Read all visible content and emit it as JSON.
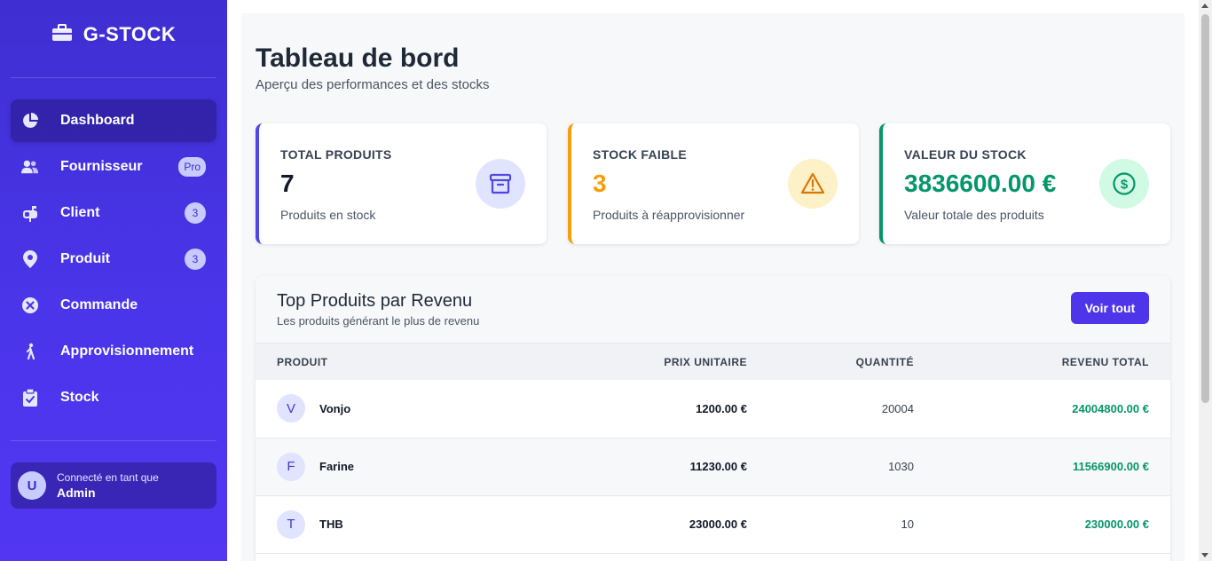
{
  "sidebar": {
    "brand": "G-STOCK",
    "items": [
      {
        "label": "Dashboard",
        "icon": "pie-chart-icon",
        "active": true,
        "badge": ""
      },
      {
        "label": "Fournisseur",
        "icon": "users-icon",
        "active": false,
        "badge": "Pro"
      },
      {
        "label": "Client",
        "icon": "mailbox-icon",
        "active": false,
        "badge": "3"
      },
      {
        "label": "Produit",
        "icon": "location-pin-icon",
        "active": false,
        "badge": "3"
      },
      {
        "label": "Commande",
        "icon": "x-circle-icon",
        "active": false,
        "badge": ""
      },
      {
        "label": "Approvisionnement",
        "icon": "person-walking-icon",
        "active": false,
        "badge": ""
      },
      {
        "label": "Stock",
        "icon": "clipboard-check-icon",
        "active": false,
        "badge": ""
      }
    ],
    "user": {
      "avatar_letter": "U",
      "caption": "Connecté en tant que",
      "name": "Admin"
    }
  },
  "header": {
    "title": "Tableau de bord",
    "subtitle": "Aperçu des performances et des stocks"
  },
  "stats": [
    {
      "label": "TOTAL PRODUITS",
      "value": "7",
      "description": "Produits en stock",
      "color": "#4f46e5",
      "icon": "archive-box-icon"
    },
    {
      "label": "STOCK FAIBLE",
      "value": "3",
      "description": "Produits à réapprovisionner",
      "color": "#f59e0b",
      "icon": "warning-triangle-icon"
    },
    {
      "label": "VALEUR DU STOCK",
      "value": "3836600.00 €",
      "description": "Valeur totale des produits",
      "color": "#059669",
      "icon": "dollar-circle-icon"
    }
  ],
  "top_products": {
    "title": "Top Produits par Revenu",
    "subtitle": "Les produits générant le plus de revenu",
    "button_label": "Voir tout",
    "columns": [
      "PRODUIT",
      "PRIX UNITAIRE",
      "QUANTITÉ",
      "REVENU TOTAL"
    ],
    "rows": [
      {
        "letter": "V",
        "name": "Vonjo",
        "price": "1200.00 €",
        "quantity": "20004",
        "revenue": "24004800.00 €"
      },
      {
        "letter": "F",
        "name": "Farine",
        "price": "11230.00 €",
        "quantity": "1030",
        "revenue": "11566900.00 €"
      },
      {
        "letter": "T",
        "name": "THB",
        "price": "23000.00 €",
        "quantity": "10",
        "revenue": "230000.00 €"
      }
    ]
  }
}
